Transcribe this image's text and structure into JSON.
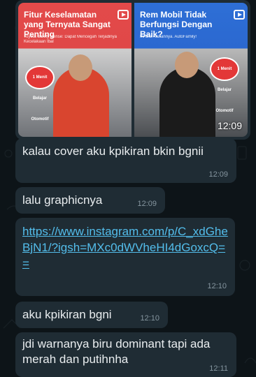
{
  "image_message": {
    "left_thumb": {
      "headline": "Fitur Keselamatan yang Ternyata Sangat Penting",
      "sub": "Toyota Safety Sense: Dapat Mencegah Terjadinya Kecelakaan Ibal",
      "badge": "1 Menit Belajar Otomotif"
    },
    "right_thumb": {
      "headline": "Rem Mobil Tidak Berfungsi Dengan Baik?",
      "sub": "Ini Dia Alasannya. AutoFamily!",
      "badge": "1 Menit Belajar Otomotif"
    },
    "time": "12:09"
  },
  "messages": [
    {
      "text": "kalau cover aku kpikiran bkin bgnii",
      "time": "12:09"
    },
    {
      "text": "lalu graphicnya",
      "time": "12:09"
    },
    {
      "link": "https://www.instagram.com/p/C_xdGheBjN1/?igsh=MXc0dWVheHI4dGoxcQ==",
      "time": "12:10"
    },
    {
      "text": "aku kpikiran bgni",
      "time": "12:10"
    },
    {
      "text": "jdi warnanya biru dominant tapi ada merah dan putihnha",
      "time": "12:11"
    }
  ]
}
